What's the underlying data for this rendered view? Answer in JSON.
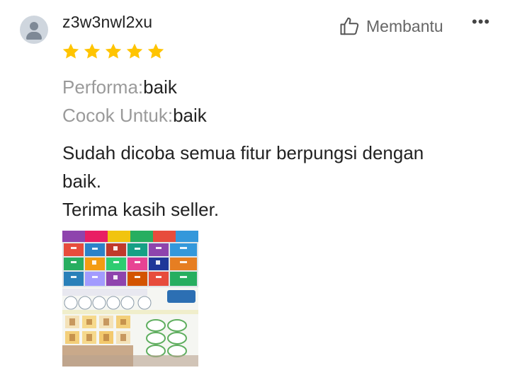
{
  "review": {
    "username": "z3w3nwl2xu",
    "rating": 5,
    "helpful_label": "Membantu",
    "more_icon": "more-horizontal-icon",
    "attributes": [
      {
        "key": "Performa:",
        "value": "baik"
      },
      {
        "key": "Cocok Untuk:",
        "value": "baik"
      }
    ],
    "text_lines": [
      "Sudah dicoba semua fitur berpungsi dengan",
      "baik.",
      "Terima kasih seller."
    ]
  },
  "colors": {
    "star": "#FFC400",
    "muted": "#9A9A9A",
    "text": "#222222",
    "avatar_bg": "#CFD6DE"
  }
}
